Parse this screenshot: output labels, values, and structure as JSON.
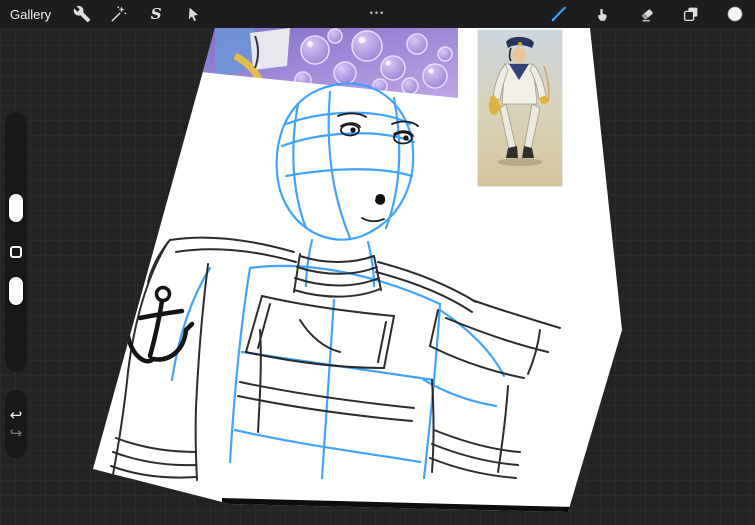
{
  "toolbar": {
    "gallery_label": "Gallery",
    "canvas_options_dots": "•••",
    "selection_glyph": "S",
    "left_tools": [
      {
        "name": "actions",
        "icon": "wrench-icon"
      },
      {
        "name": "adjustments",
        "icon": "magic-wand-icon"
      },
      {
        "name": "selection",
        "icon": "selection-s-icon"
      },
      {
        "name": "transform",
        "icon": "transform-arrow-icon"
      }
    ],
    "right_tools": [
      {
        "name": "paint",
        "icon": "paintbrush-icon",
        "active": true
      },
      {
        "name": "smudge",
        "icon": "smudge-finger-icon",
        "active": false
      },
      {
        "name": "erase",
        "icon": "eraser-icon",
        "active": false
      },
      {
        "name": "layers",
        "icon": "layers-icon",
        "active": false
      },
      {
        "name": "color",
        "icon": "color-circle-icon",
        "active": false
      }
    ],
    "active_tool_color": "#3aa2ff"
  },
  "sidebar": {
    "undo_glyph": "↩",
    "redo_glyph": "↪",
    "controls": [
      "brush-size-slider",
      "modify-button",
      "opacity-slider",
      "undo-button",
      "redo-button"
    ]
  },
  "canvas": {
    "background_color": "#ffffff",
    "sketch_line_blue": "#36a0ff",
    "sketch_line_black": "#1c1c1c",
    "references": [
      {
        "name": "bubbles-reference",
        "dominant_colors": [
          "#7f6cc9",
          "#c0a5e6",
          "#e3bd45"
        ]
      },
      {
        "name": "figure-reference",
        "dominant_colors": [
          "#cdd6de",
          "#d6c49a",
          "#27355e",
          "#dcb33e"
        ]
      }
    ]
  },
  "workspace": {
    "background_color": "#232323",
    "grid_color": "#2b2b2b",
    "toolbar_color": "#1d1d1f"
  }
}
